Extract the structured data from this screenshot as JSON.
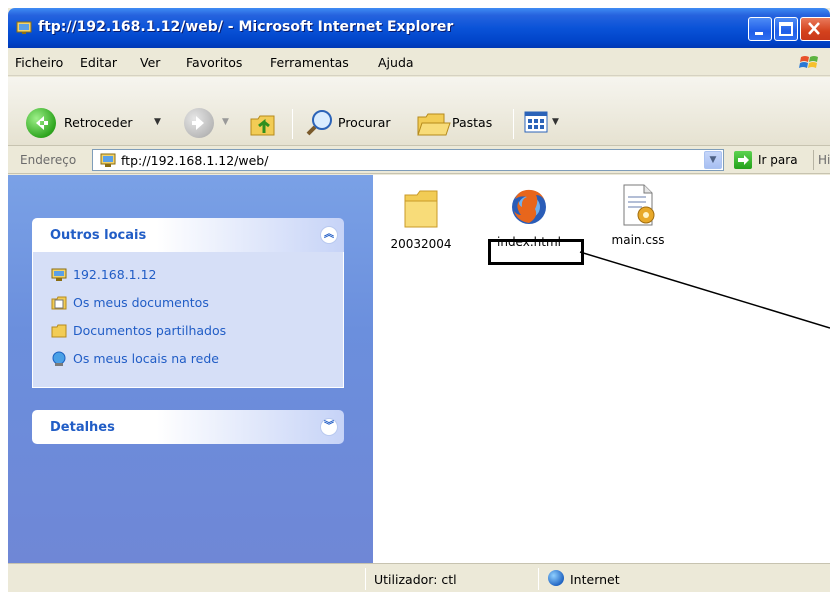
{
  "window": {
    "title": "ftp://192.168.1.12/web/ - Microsoft Internet Explorer"
  },
  "menu": {
    "items": [
      "Ficheiro",
      "Editar",
      "Ver",
      "Favoritos",
      "Ferramentas",
      "Ajuda"
    ]
  },
  "toolbar": {
    "back_label": "Retroceder",
    "search_label": "Procurar",
    "folders_label": "Pastas"
  },
  "address": {
    "label": "Endereço",
    "value": "ftp://192.168.1.12/web/",
    "go_label": "Ir para",
    "links_label": "Hiperligações"
  },
  "sidebar": {
    "other_places": {
      "title": "Outros locais",
      "items": [
        {
          "label": "192.168.1.12",
          "icon": "ftp-server-icon"
        },
        {
          "label": "Os meus documentos",
          "icon": "my-documents-icon"
        },
        {
          "label": "Documentos partilhados",
          "icon": "shared-documents-icon"
        },
        {
          "label": "Os meus locais na rede",
          "icon": "network-places-icon"
        }
      ]
    },
    "details": {
      "title": "Detalhes"
    }
  },
  "files": [
    {
      "name": "20032004",
      "icon": "folder-icon"
    },
    {
      "name": "index.html",
      "icon": "firefox-html-icon"
    },
    {
      "name": "main.css",
      "icon": "css-file-icon"
    }
  ],
  "status": {
    "user_text": "Utilizador: ctl",
    "zone_text": "Internet"
  },
  "colors": {
    "title_bar": "#0a53d8",
    "task_pane": "#6f87d6",
    "link_text": "#215dc6",
    "highlight_border": "#000000"
  }
}
